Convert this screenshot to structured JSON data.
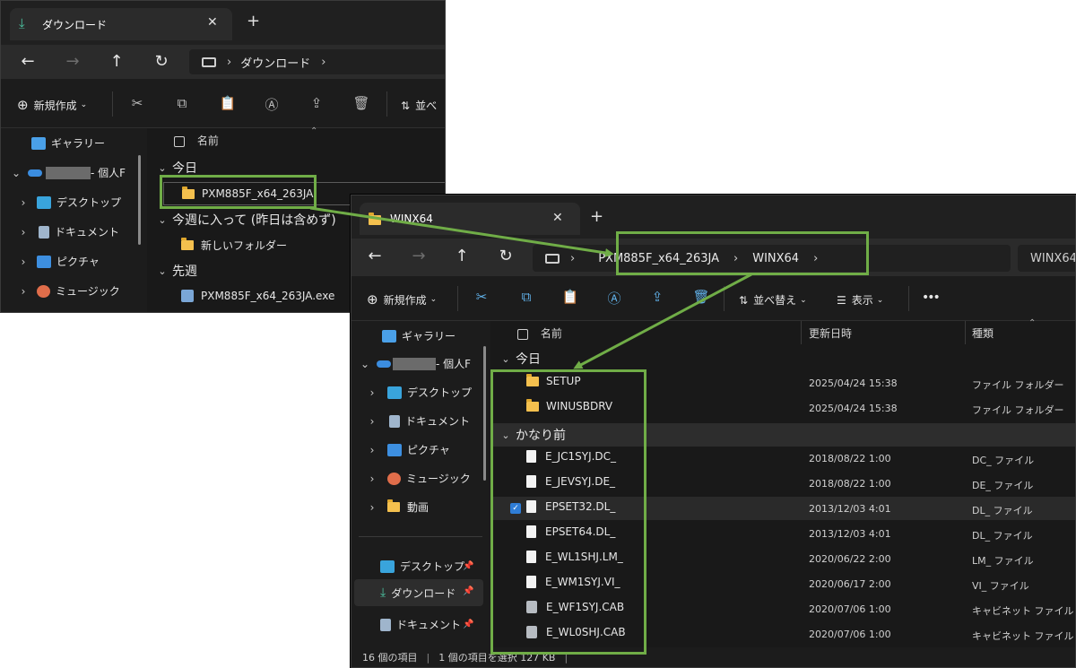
{
  "win1": {
    "tab_title": "ダウンロード",
    "breadcrumb": [
      "ダウンロード"
    ],
    "toolbar": {
      "new_label": "新規作成",
      "sort_label": "並べ"
    },
    "sidebar": [
      {
        "label": "ギャラリー",
        "icon": "gallery-icon"
      },
      {
        "label": "- 個人F",
        "icon": "onedrive-icon"
      },
      {
        "label": "デスクトップ",
        "icon": "desktop-icon"
      },
      {
        "label": "ドキュメント",
        "icon": "document-icon"
      },
      {
        "label": "ピクチャ",
        "icon": "pictures-icon"
      },
      {
        "label": "ミュージック",
        "icon": "music-icon"
      }
    ],
    "name_header": "名前",
    "groups": [
      {
        "label": "今日",
        "items": [
          {
            "name": "PXM885F_x64_263JA",
            "icon": "folder-icon"
          }
        ]
      },
      {
        "label": "今週に入って (昨日は含めず)",
        "items": [
          {
            "name": "新しいフォルダー",
            "icon": "folder-icon"
          }
        ]
      },
      {
        "label": "先週",
        "items": [
          {
            "name": "PXM885F_x64_263JA.exe",
            "icon": "installer-icon"
          }
        ]
      }
    ]
  },
  "win2": {
    "tab_title": "WINX64",
    "breadcrumb": [
      "PXM885F_x64_263JA",
      "WINX64"
    ],
    "search_text": "WINX64",
    "toolbar": {
      "new_label": "新規作成",
      "sort_label": "並べ替え",
      "view_label": "表示",
      "more_label": "•••"
    },
    "sidebar": [
      {
        "label": "ギャラリー",
        "icon": "gallery-icon"
      },
      {
        "label": "- 個人F",
        "icon": "onedrive-icon"
      },
      {
        "label": "デスクトップ",
        "icon": "desktop-icon"
      },
      {
        "label": "ドキュメント",
        "icon": "document-icon"
      },
      {
        "label": "ピクチャ",
        "icon": "pictures-icon"
      },
      {
        "label": "ミュージック",
        "icon": "music-icon"
      },
      {
        "label": "動画",
        "icon": "video-folder-icon"
      }
    ],
    "quick_access": [
      {
        "label": "デスクトップ",
        "icon": "desktop-icon"
      },
      {
        "label": "ダウンロード",
        "icon": "download-icon"
      },
      {
        "label": "ドキュメント",
        "icon": "document-icon"
      }
    ],
    "columns": {
      "name": "名前",
      "modified": "更新日時",
      "type": "種類"
    },
    "groups": [
      {
        "label": "今日",
        "rows": [
          {
            "name": "SETUP",
            "modified": "2025/04/24 15:38",
            "type": "ファイル フォルダー",
            "icon": "folder-icon",
            "selected": false
          },
          {
            "name": "WINUSBDRV",
            "modified": "2025/04/24 15:38",
            "type": "ファイル フォルダー",
            "icon": "folder-icon",
            "selected": false
          }
        ]
      },
      {
        "label": "かなり前",
        "rows": [
          {
            "name": "E_JC1SYJ.DC_",
            "modified": "2018/08/22 1:00",
            "type": "DC_ ファイル",
            "icon": "file-icon",
            "selected": false
          },
          {
            "name": "E_JEVSYJ.DE_",
            "modified": "2018/08/22 1:00",
            "type": "DE_ ファイル",
            "icon": "file-icon",
            "selected": false
          },
          {
            "name": "EPSET32.DL_",
            "modified": "2013/12/03 4:01",
            "type": "DL_ ファイル",
            "icon": "file-icon",
            "selected": true
          },
          {
            "name": "EPSET64.DL_",
            "modified": "2013/12/03 4:01",
            "type": "DL_ ファイル",
            "icon": "file-icon",
            "selected": false
          },
          {
            "name": "E_WL1SHJ.LM_",
            "modified": "2020/06/22 2:00",
            "type": "LM_ ファイル",
            "icon": "file-icon",
            "selected": false
          },
          {
            "name": "E_WM1SYJ.VI_",
            "modified": "2020/06/17 2:00",
            "type": "VI_ ファイル",
            "icon": "file-icon",
            "selected": false
          },
          {
            "name": "E_WF1SYJ.CAB",
            "modified": "2020/07/06 1:00",
            "type": "キャビネット ファイル",
            "icon": "cabinet-icon",
            "selected": false
          },
          {
            "name": "E_WL0SHJ.CAB",
            "modified": "2020/07/06 1:00",
            "type": "キャビネット ファイル",
            "icon": "cabinet-icon",
            "selected": false
          }
        ]
      }
    ],
    "status": {
      "count": "16 個の項目",
      "selection": "1 個の項目を選択  127 KB"
    }
  },
  "colors": {
    "highlight": "#70ad47",
    "folder": "#f4c04e",
    "accent": "#2f7dd6"
  }
}
